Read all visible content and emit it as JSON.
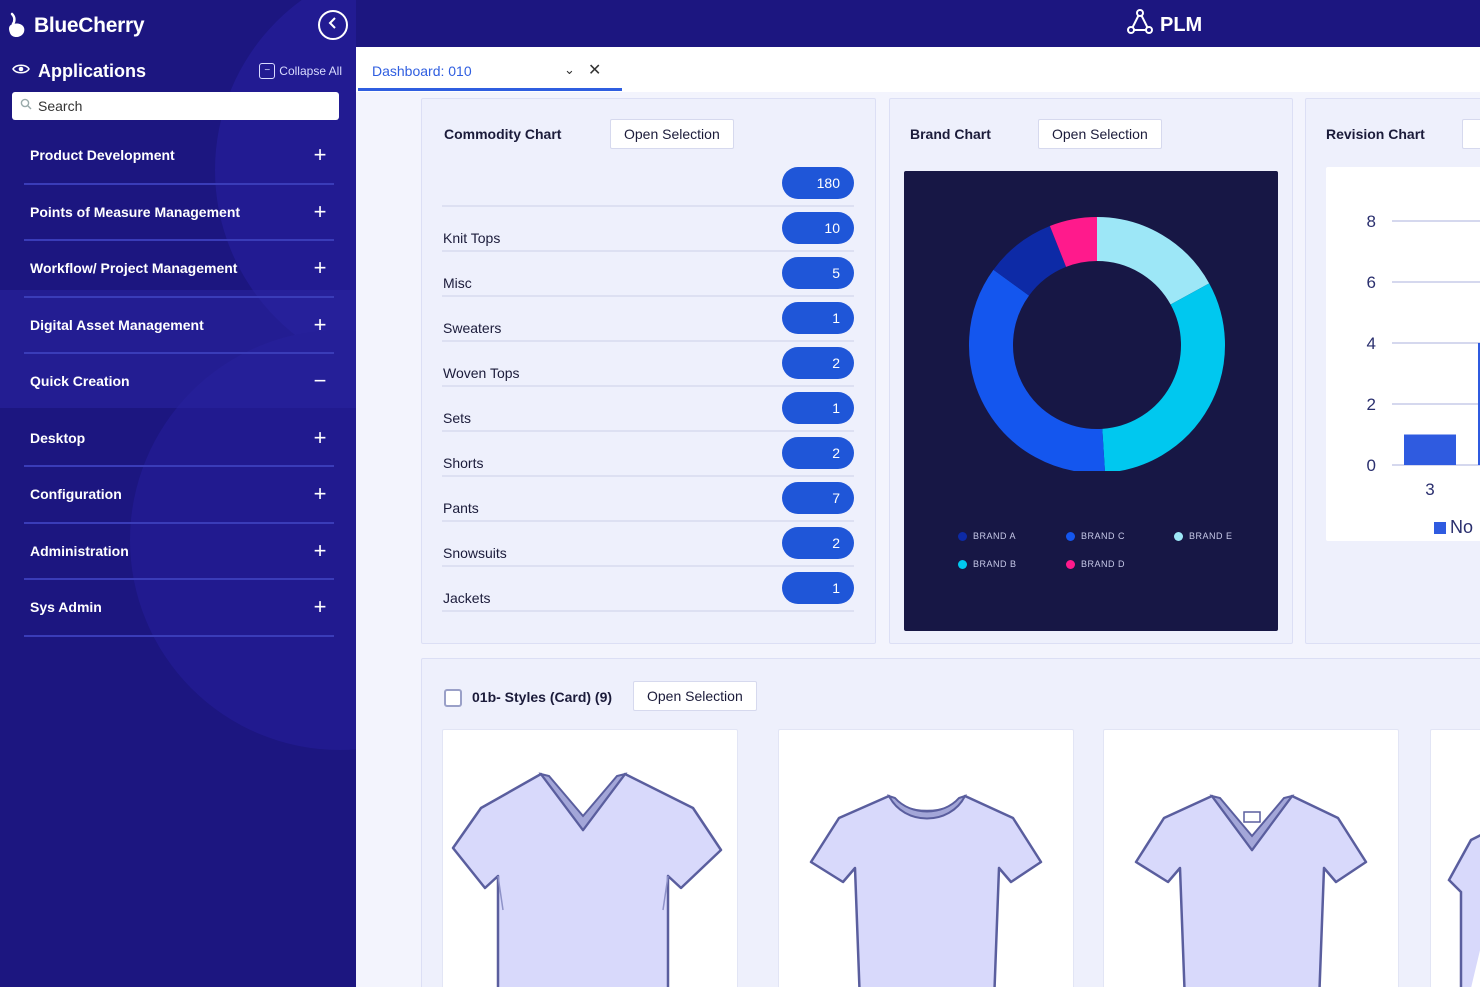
{
  "sidebar": {
    "brand_name": "BlueCherry",
    "apps_title": "Applications",
    "collapse_all": "Collapse All",
    "search_placeholder": "Search",
    "items": [
      {
        "label": "Product Development",
        "sign": "+"
      },
      {
        "label": "Points of Measure Management",
        "sign": "+"
      },
      {
        "label": "Workflow/ Project Management",
        "sign": "+"
      },
      {
        "label": "Digital Asset Management",
        "sign": "+"
      },
      {
        "label": "Quick Creation",
        "sign": "−"
      },
      {
        "label": "Desktop",
        "sign": "+"
      },
      {
        "label": "Configuration",
        "sign": "+"
      },
      {
        "label": "Administration",
        "sign": "+"
      },
      {
        "label": "Sys Admin",
        "sign": "+"
      }
    ]
  },
  "topbar": {
    "app_name": "PLM"
  },
  "tabs": [
    {
      "label": "Dashboard: 010",
      "caret": "⌄",
      "close": "✕"
    }
  ],
  "commodity": {
    "title": "Commodity Chart",
    "open_label": "Open Selection",
    "rows": [
      {
        "label": "",
        "count": "180"
      },
      {
        "label": "Knit Tops",
        "count": "10"
      },
      {
        "label": "Misc",
        "count": "5"
      },
      {
        "label": "Sweaters",
        "count": "1"
      },
      {
        "label": "Woven Tops",
        "count": "2"
      },
      {
        "label": "Sets",
        "count": "1"
      },
      {
        "label": "Shorts",
        "count": "2"
      },
      {
        "label": "Pants",
        "count": "7"
      },
      {
        "label": "Snowsuits",
        "count": "2"
      },
      {
        "label": "Jackets",
        "count": "1"
      }
    ]
  },
  "brand_chart": {
    "title": "Brand Chart",
    "open_label": "Open Selection"
  },
  "revision": {
    "title": "Revision Chart",
    "legend_label": "No"
  },
  "styles": {
    "title": "01b- Styles (Card) (9)",
    "open_label": "Open Selection"
  },
  "chart_data": [
    {
      "type": "pie",
      "title": "Brand Chart",
      "donut": true,
      "labels": [
        "BRAND A",
        "BRAND B",
        "BRAND C",
        "BRAND D",
        "BRAND E"
      ],
      "values": [
        9,
        32,
        36,
        6,
        17
      ],
      "colors": [
        "#0d2aa6",
        "#00c8ef",
        "#1456ee",
        "#ff1a8c",
        "#9de7f7"
      ],
      "legend": "bottom"
    },
    {
      "type": "bar",
      "title": "Revision Chart",
      "categories": [
        "3"
      ],
      "series": [
        {
          "name": "No",
          "values": [
            1
          ]
        }
      ],
      "yticks": [
        "0",
        "2",
        "4",
        "6",
        "8"
      ],
      "ylim": [
        0,
        8
      ],
      "color": "#2f5be0"
    }
  ]
}
